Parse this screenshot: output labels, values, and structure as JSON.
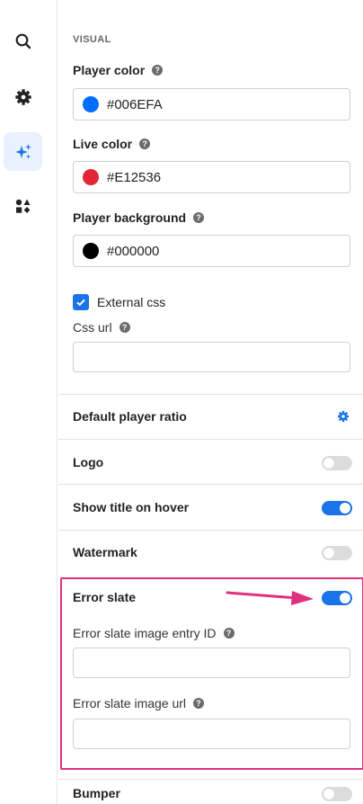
{
  "rail": {
    "items": [
      {
        "icon": "search-icon"
      },
      {
        "icon": "gear-icon"
      },
      {
        "icon": "sparkle-icon",
        "active": true
      },
      {
        "icon": "shapes-icon"
      }
    ]
  },
  "visual": {
    "section_label": "VISUAL",
    "player_color": {
      "label": "Player color",
      "value": "#006EFA",
      "swatch": "#006EFA"
    },
    "live_color": {
      "label": "Live color",
      "value": "#E12536",
      "swatch": "#E12536"
    },
    "player_background": {
      "label": "Player background",
      "value": "#000000",
      "swatch": "#000000"
    },
    "external_css": {
      "label": "External css",
      "checked": true
    },
    "css_url": {
      "label": "Css url",
      "value": ""
    }
  },
  "rows": {
    "default_player_ratio": {
      "label": "Default player ratio"
    },
    "logo": {
      "label": "Logo",
      "on": false
    },
    "show_title_on_hover": {
      "label": "Show title on hover",
      "on": true
    },
    "watermark": {
      "label": "Watermark",
      "on": false
    },
    "error_slate": {
      "label": "Error slate",
      "on": true,
      "image_entry_id": {
        "label": "Error slate image entry ID",
        "value": ""
      },
      "image_url": {
        "label": "Error slate image url",
        "value": ""
      }
    },
    "bumper": {
      "label": "Bumper",
      "on": false
    }
  },
  "colors": {
    "accent": "#1a73e8",
    "highlight": "#e0307f",
    "toggle_off": "#dcdcdc"
  }
}
